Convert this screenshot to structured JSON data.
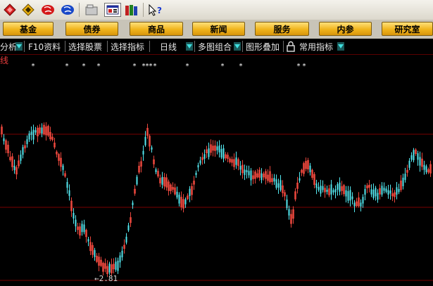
{
  "toolbar": {
    "icons": [
      "red-diamond-icon",
      "gold-diamond-icon",
      "red-ball-icon",
      "blue-ball-icon",
      "folder-icon",
      "window-icon",
      "books-icon",
      "help-pointer-icon"
    ]
  },
  "menu": {
    "items": [
      "基金",
      "债券",
      "商品",
      "新闻",
      "服务",
      "内参",
      "研究室"
    ]
  },
  "funcbar": {
    "analysis": "分析",
    "f10": "F10资料",
    "select_stock": "选择股票",
    "select_indicator": "选择指标",
    "period": "日线",
    "multi_chart": "多图组合",
    "overlay": "图形叠加",
    "common_indicators": "常用指标"
  },
  "chart_data": {
    "type": "candlestick",
    "title": "线",
    "low_label": "2.81",
    "colors": {
      "up": "#e8463c",
      "down": "#54e8f0",
      "grid": "#7a0000"
    }
  }
}
